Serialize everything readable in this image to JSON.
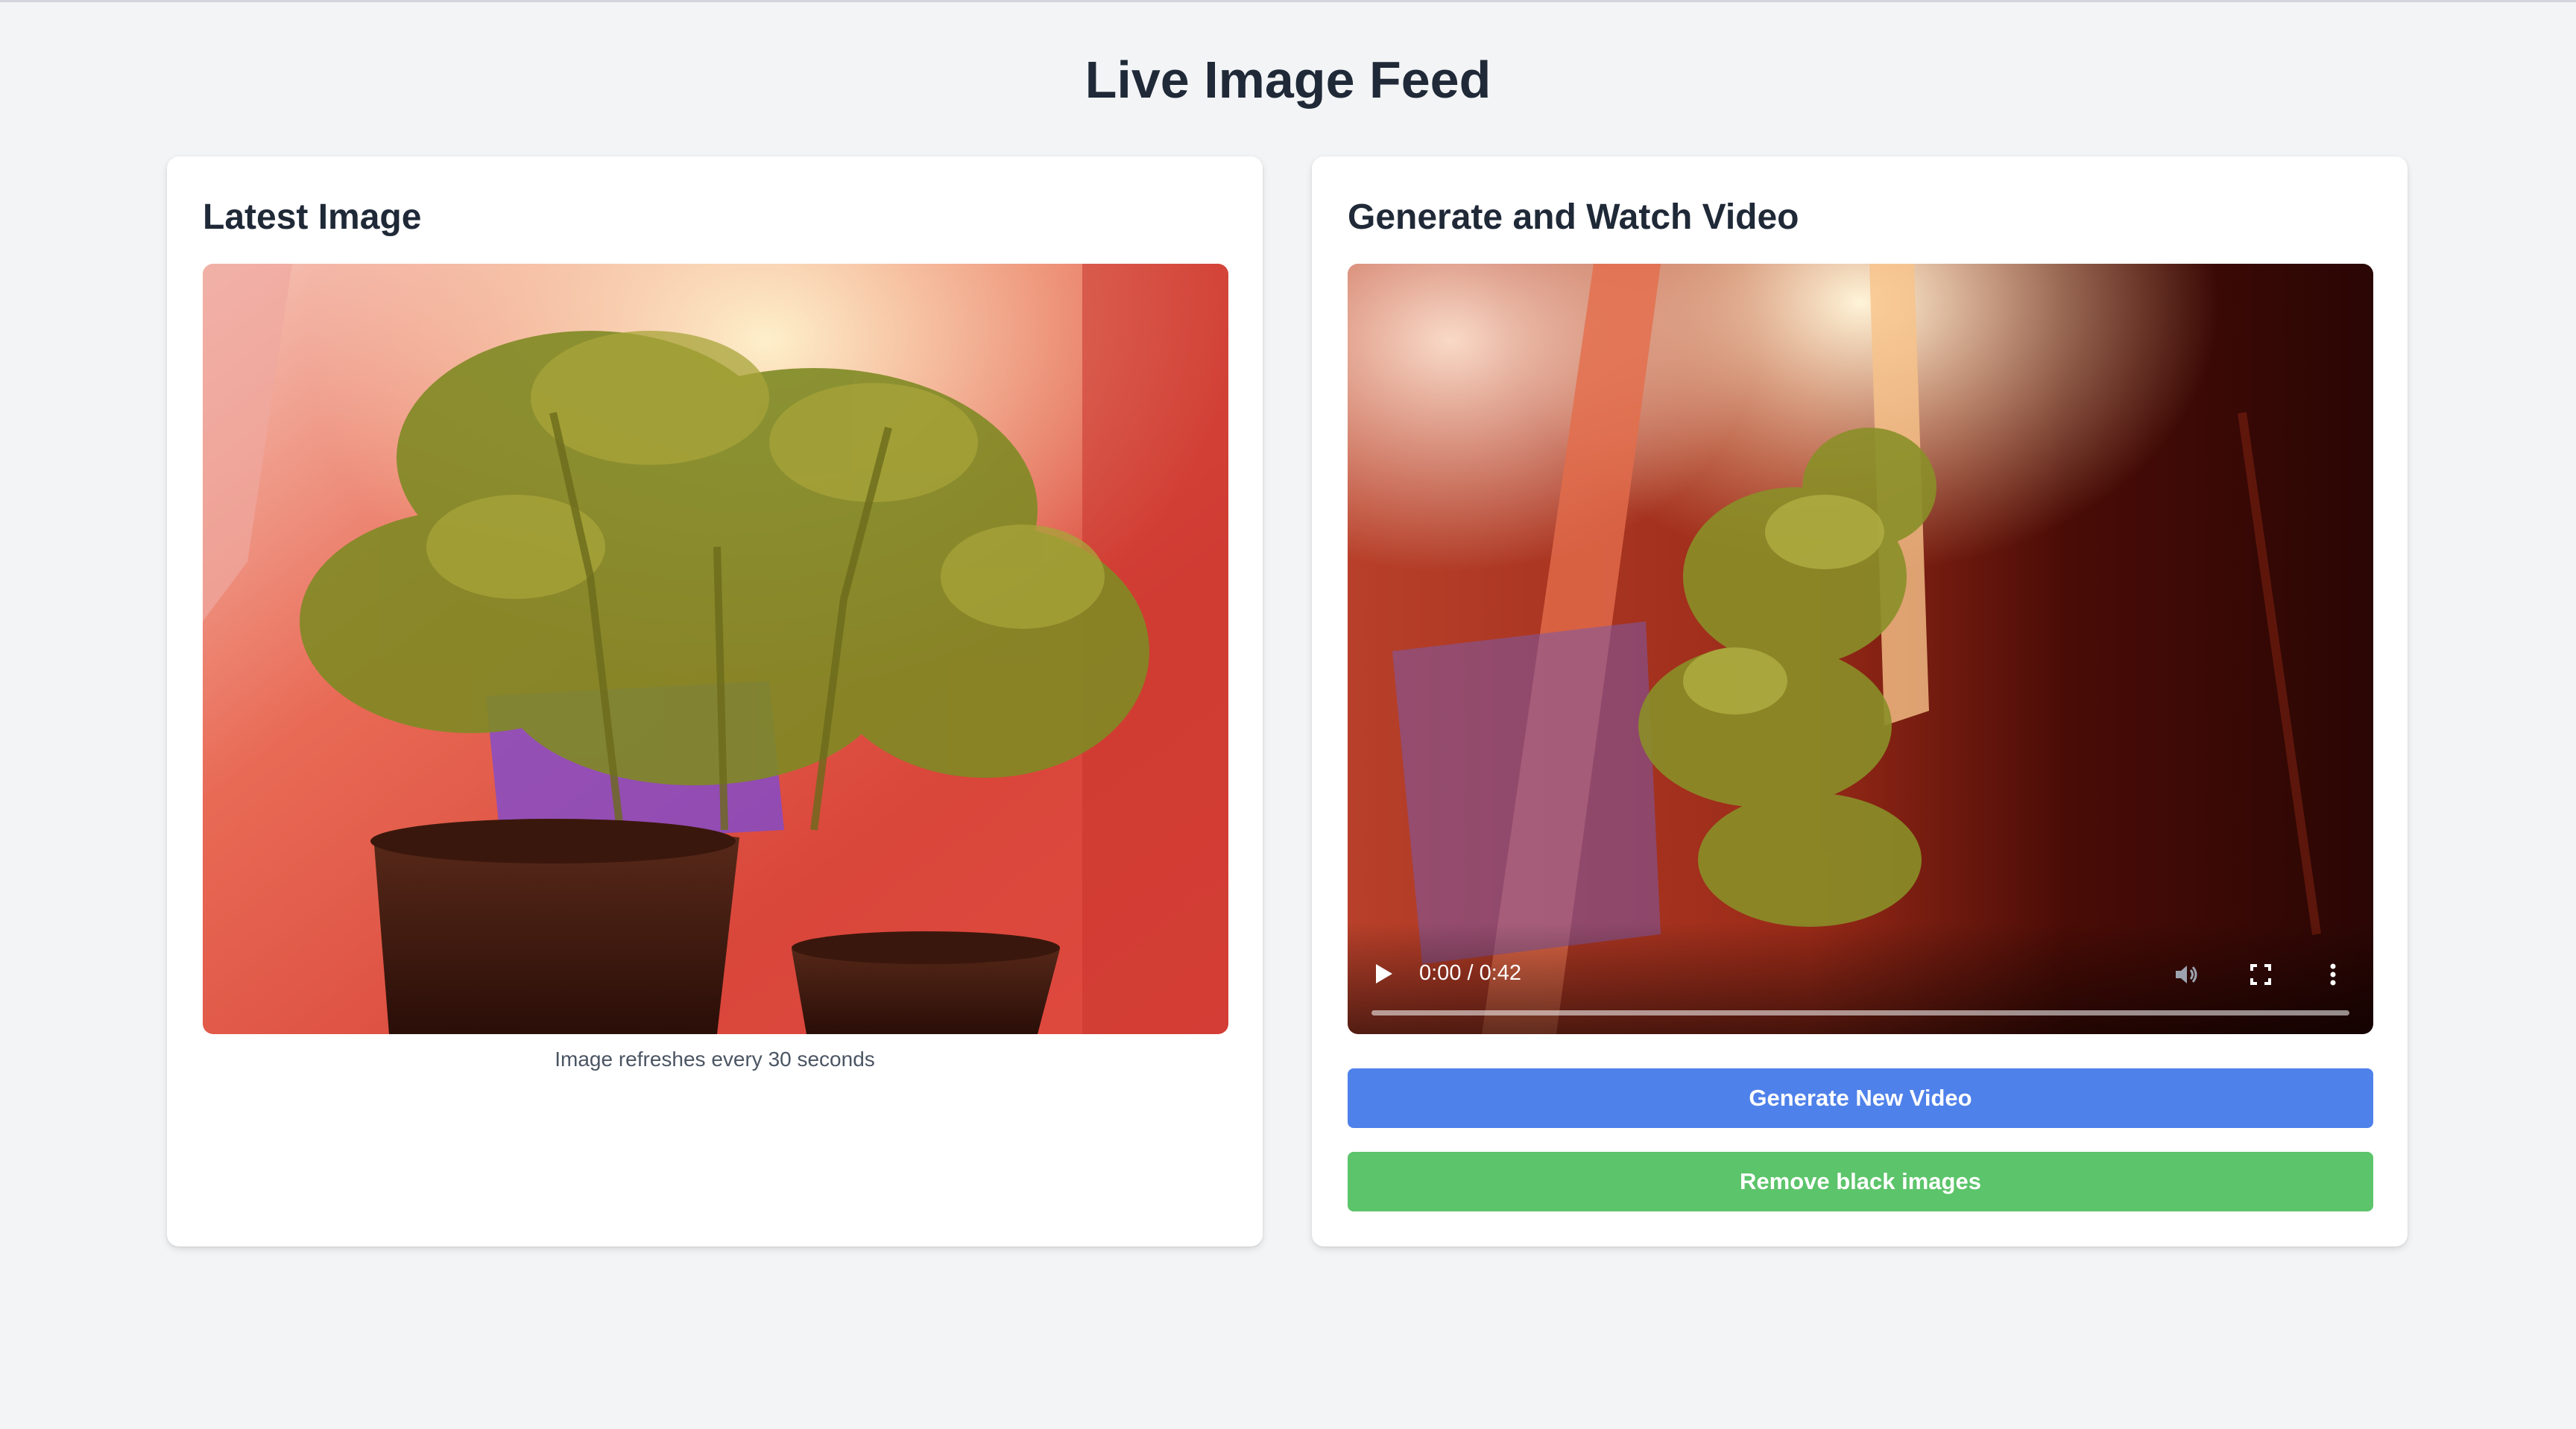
{
  "page": {
    "title": "Live Image Feed"
  },
  "latest_image": {
    "title": "Latest Image",
    "caption": "Image refreshes every 30 seconds"
  },
  "video_panel": {
    "title": "Generate and Watch Video",
    "player": {
      "time": "0:00 / 0:42",
      "progress": 0
    },
    "buttons": {
      "generate": "Generate New Video",
      "remove_black": "Remove black images"
    }
  },
  "colors": {
    "background": "#f3f4f6",
    "card": "#ffffff",
    "generate_button": "#4f81ea",
    "remove_button": "#5cc46a",
    "title_text": "#1f2937"
  },
  "icons": [
    "play-icon",
    "volume-icon",
    "fullscreen-icon",
    "more-options-icon"
  ]
}
